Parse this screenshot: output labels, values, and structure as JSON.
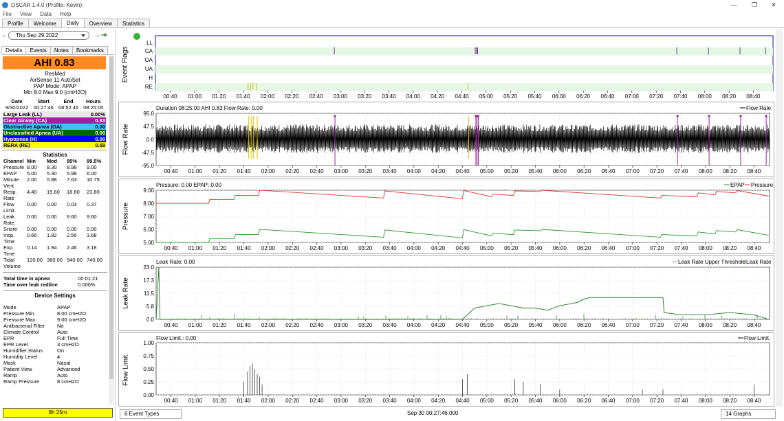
{
  "window": {
    "title": "OSCAR 1.4.0 (Profile: Kevin)"
  },
  "menu": [
    "File",
    "View",
    "Data",
    "Help"
  ],
  "tabs": [
    "Profile",
    "Welcome",
    "Daily",
    "Overview",
    "Statistics"
  ],
  "date": "Thu Sep 29 2022",
  "subtabs": [
    "Details",
    "Events",
    "Notes",
    "Bookmarks"
  ],
  "summary": {
    "ahi": "AHI 0.83",
    "machine": "ResMed",
    "model": "AirSense 11 AutoSet",
    "mode": "PAP Mode: APAP",
    "range": "Min 8.0 Max 9.0 (cmH2O)"
  },
  "session": {
    "headers": [
      "Date",
      "Start",
      "End",
      "Hours"
    ],
    "values": [
      "9/30/2022",
      "00:27:46",
      "08:52:46",
      "08:25:00"
    ]
  },
  "indices": [
    {
      "label": "Large Leak (LL)",
      "value": "0.00%",
      "bg": "#e8e8e8",
      "fg": "#000000"
    },
    {
      "label": "Clear Airway (CA)",
      "value": "0.83",
      "bg": "#a020a0",
      "fg": "#ffffff"
    },
    {
      "label": "Obstructive Apnea (OA)",
      "value": "0.00",
      "bg": "#40c0ff",
      "fg": "#000000"
    },
    {
      "label": "Unclassified Apnea (UA)",
      "value": "0.00",
      "bg": "#006400",
      "fg": "#ffffff"
    },
    {
      "label": "Hypopnea (H)",
      "value": "0.00",
      "bg": "#0000ff",
      "fg": "#ffffff"
    },
    {
      "label": "RERA (RE)",
      "value": "0.59",
      "bg": "#ffff00",
      "fg": "#000000"
    }
  ],
  "stats": {
    "title": "Statistics",
    "headers": [
      "Channel",
      "Min",
      "Med",
      "95%",
      "99.5%"
    ],
    "rows": [
      [
        "Pressure",
        "8.00",
        "8.30",
        "8.98",
        "9.00"
      ],
      [
        "EPAP",
        "5.00",
        "5.30",
        "5.98",
        "6.00"
      ],
      [
        "Minute Vent.",
        "2.00",
        "5.88",
        "7.63",
        "10.75"
      ],
      [
        "Resp. Rate",
        "4.40",
        "15.60",
        "18.80",
        "23.80"
      ],
      [
        "Flow Limit.",
        "0.00",
        "0.00",
        "0.03",
        "0.37"
      ],
      [
        "Leak Rate",
        "0.00",
        "0.00",
        "9.60",
        "9.60"
      ],
      [
        "Snore",
        "0.00",
        "0.00",
        "0.00",
        "0.00"
      ],
      [
        "Insp. Time",
        "0.66",
        "1.82",
        "2.56",
        "3.68"
      ],
      [
        "Exp. Time",
        "0.14",
        "1.94",
        "2.46",
        "3.18"
      ],
      [
        "Tidal Volume",
        "120.00",
        "380.00",
        "540.00",
        "740.00"
      ]
    ]
  },
  "apnea": {
    "total_label": "Total time in apnea",
    "total_value": "00:01:21",
    "leak_label": "Time over leak redline",
    "leak_value": "0.000%"
  },
  "device": {
    "title": "Device Settings",
    "rows": [
      [
        "Mode",
        "APAP"
      ],
      [
        "Pressure Min",
        "8.00 cmH2O"
      ],
      [
        "Pressure Max",
        "9.00 cmH2O"
      ],
      [
        "Antibacterial Filter",
        "No"
      ],
      [
        "Climate Control",
        "Auto"
      ],
      [
        "EPR",
        "Full Time"
      ],
      [
        "EPR Level",
        "3 cmH2O"
      ],
      [
        "Humidifier Status",
        "On"
      ],
      [
        "Humidity Level",
        "4"
      ],
      [
        "Mask",
        "Nasal"
      ],
      [
        "Patient View",
        "Advanced"
      ],
      [
        "Ramp",
        "Auto"
      ],
      [
        "Ramp Pressure",
        "8 cmH2O"
      ]
    ]
  },
  "duration": "8h 25m",
  "time_ticks": [
    "00:40",
    "01:00",
    "01:20",
    "01:40",
    "02:00",
    "02:20",
    "02:40",
    "03:00",
    "03:20",
    "03:40",
    "04:00",
    "04:20",
    "04:40",
    "05:00",
    "05:20",
    "05:40",
    "06:00",
    "06:20",
    "06:40",
    "07:00",
    "07:20",
    "07:40",
    "08:00",
    "08:20",
    "08:40"
  ],
  "charts": {
    "flags": {
      "label": "Event Flags",
      "rows": [
        "LL",
        "CA",
        "OA",
        "UA",
        "H",
        "RE"
      ],
      "ca_events": [
        "02:55",
        "04:51",
        "04:52",
        "04:53",
        "07:37",
        "08:03",
        "08:29",
        "08:50"
      ],
      "re_events": [
        "01:44",
        "01:46",
        "01:48",
        "01:51",
        "04:45"
      ]
    },
    "flow": {
      "label": "Flow Rate",
      "header": "Duration 08:25:00 AHI 0.83 Flow Rate: 0.00",
      "legend": "Flow Rate",
      "yticks": [
        "95.0",
        "47.5",
        "0.0",
        "-47.5",
        "-95.0"
      ]
    },
    "pressure": {
      "label": "Pressure",
      "header": "Pressure: 0.00 EPAP: 0.00",
      "legend_epap": "EPAP",
      "legend_pressure": "Pressure",
      "yticks": [
        "9.00",
        "8.00",
        "7.00",
        "6.00",
        "5.00"
      ],
      "pressure_series": {
        "x": [
          "00:27",
          "01:11",
          "01:12",
          "01:32",
          "01:33",
          "01:52",
          "01:53",
          "03:35",
          "03:36",
          "04:40",
          "04:41",
          "05:04",
          "05:05",
          "05:22",
          "05:23",
          "05:44",
          "05:45",
          "07:23",
          "07:24",
          "07:53",
          "07:54",
          "08:08",
          "08:09",
          "08:25",
          "08:26",
          "08:52"
        ],
        "y": [
          8.0,
          8.0,
          8.3,
          8.3,
          8.6,
          8.6,
          9.0,
          8.4,
          8.95,
          8.35,
          8.98,
          8.5,
          8.7,
          8.6,
          8.95,
          8.9,
          9.0,
          8.4,
          8.6,
          8.5,
          8.8,
          8.65,
          8.9,
          8.8,
          8.98,
          8.55
        ]
      },
      "epap_series": {
        "x": [
          "00:27",
          "01:11",
          "01:12",
          "01:32",
          "01:33",
          "01:52",
          "01:53",
          "03:35",
          "03:36",
          "04:40",
          "04:41",
          "05:04",
          "05:05",
          "05:22",
          "05:23",
          "05:44",
          "05:45",
          "07:23",
          "07:24",
          "07:53",
          "07:54",
          "08:08",
          "08:09",
          "08:25",
          "08:26",
          "08:52"
        ],
        "y": [
          5.0,
          5.0,
          5.3,
          5.3,
          5.6,
          5.6,
          6.0,
          5.4,
          5.95,
          5.35,
          5.98,
          5.5,
          5.7,
          5.6,
          5.95,
          5.9,
          6.0,
          5.4,
          5.6,
          5.5,
          5.8,
          5.65,
          5.9,
          5.8,
          5.98,
          5.55
        ]
      }
    },
    "leak": {
      "label": "Leak Rate",
      "header": "Leak Rate: 0.00",
      "legend_thresh": "Leak Rate Upper Threshold",
      "legend_leak": "Leak Rate",
      "yticks": [
        "23.0",
        "17.3",
        "11.5",
        "5.8",
        "0.0"
      ],
      "series": {
        "x": [
          "00:27",
          "00:30",
          "00:31",
          "04:40",
          "04:50",
          "05:00",
          "05:10",
          "05:20",
          "05:30",
          "05:40",
          "05:50",
          "06:00",
          "06:10",
          "06:15",
          "06:20",
          "06:25",
          "07:25",
          "07:26",
          "07:40",
          "08:00",
          "08:20",
          "08:40",
          "08:52"
        ],
        "y": [
          0,
          23,
          0,
          0,
          5,
          6,
          7,
          6,
          5,
          5,
          4,
          6,
          7,
          7.5,
          9,
          9.6,
          9.6,
          3,
          2,
          2,
          3,
          2,
          0
        ]
      }
    },
    "flowlimit": {
      "label": "Flow Limit.",
      "header": "Flow Limit.: 0.00",
      "legend": "Flow Limit.",
      "yticks": [
        "1.00",
        "0.75",
        "0.50",
        "0.25",
        "0.00"
      ],
      "spikes": {
        "x": [
          "01:40",
          "01:43",
          "01:45",
          "01:47",
          "01:49",
          "01:51",
          "01:53",
          "01:55",
          "04:40",
          "04:44",
          "05:23",
          "05:30",
          "05:44",
          "06:00",
          "07:08",
          "07:25",
          "08:40"
        ],
        "y": [
          0.25,
          0.45,
          0.55,
          0.6,
          0.5,
          0.4,
          0.35,
          0.2,
          0.3,
          0.4,
          0.3,
          0.25,
          0.2,
          0.1,
          0.1,
          0.1,
          0.2
        ]
      }
    }
  },
  "bottom": {
    "event_types": "6 Event Types",
    "timestamp": "Sep 30 00:27:46.000",
    "graphs": "14 Graphs"
  }
}
